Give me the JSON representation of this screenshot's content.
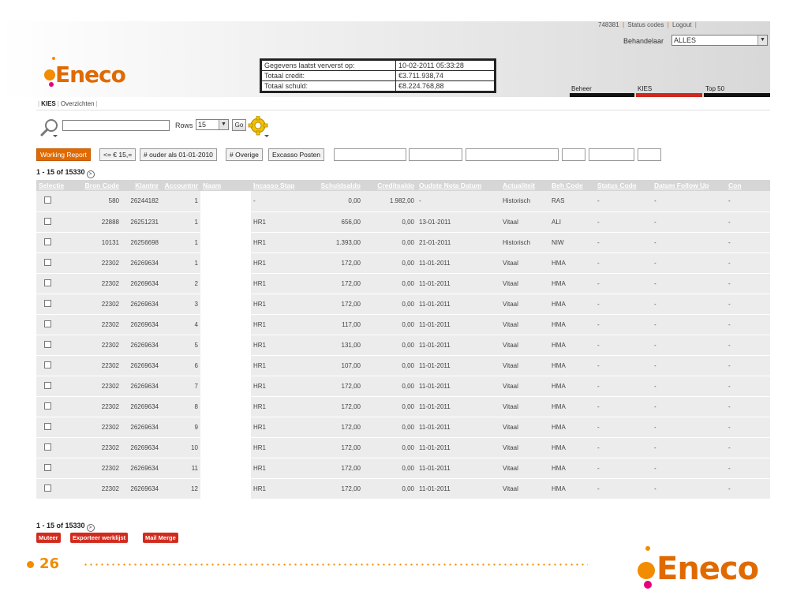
{
  "header": {
    "user_id": "748381",
    "links": [
      "Status codes",
      "Logout"
    ],
    "behandelaar_label": "Behandelaar",
    "behandelaar_value": "ALLES"
  },
  "logo_text": "Eneco",
  "info": [
    {
      "label": "Gegevens laatst ververst op:",
      "value": "10-02-2011 05:33:28"
    },
    {
      "label": "Totaal credit:",
      "value": "€3.711.938,74"
    },
    {
      "label": "Totaal schuld:",
      "value": "€8.224.768,88"
    }
  ],
  "right_tabs": [
    {
      "label": "Beheer",
      "color": "#111111"
    },
    {
      "label": "KIES",
      "color": "#cc2a1e"
    },
    {
      "label": "Top 50",
      "color": "#111111"
    }
  ],
  "breadcrumb": {
    "active": "KIES",
    "item": "Overzichten"
  },
  "search": {
    "rows_label": "Rows",
    "rows_value": "15",
    "go_label": "Go"
  },
  "filters": [
    "Working Report",
    "<= € 15,=",
    "# ouder als 01-01-2010",
    "# Overige",
    "Excasso Posten"
  ],
  "pager_text": "1 - 15 of 15330",
  "columns": [
    "Selectie",
    "Bron Code",
    "Klantnr",
    "Accountnr",
    "Naam",
    "Incasso Stap",
    "Schuldsaldo",
    "Creditsaldo",
    "Oudste Nota Datum",
    "Actualiteit",
    "Beh Code",
    "Status Code",
    "Datum Follow Up",
    "Con"
  ],
  "rows": [
    [
      "580",
      "26244182",
      "1",
      "",
      "-",
      "0,00",
      "1.982,00",
      "-",
      "Historisch",
      "RAS",
      "-",
      "-",
      "-"
    ],
    [
      "22888",
      "26251231",
      "1",
      "",
      "HR1",
      "656,00",
      "0,00",
      "13-01-2011",
      "Vitaal",
      "ALI",
      "-",
      "-",
      "-"
    ],
    [
      "10131",
      "26256698",
      "1",
      "",
      "HR1",
      "1.393,00",
      "0,00",
      "21-01-2011",
      "Historisch",
      "NIW",
      "-",
      "-",
      "-"
    ],
    [
      "22302",
      "26269634",
      "1",
      "",
      "HR1",
      "172,00",
      "0,00",
      "11-01-2011",
      "Vitaal",
      "HMA",
      "-",
      "-",
      "-"
    ],
    [
      "22302",
      "26269634",
      "2",
      "",
      "HR1",
      "172,00",
      "0,00",
      "11-01-2011",
      "Vitaal",
      "HMA",
      "-",
      "-",
      "-"
    ],
    [
      "22302",
      "26269634",
      "3",
      "",
      "HR1",
      "172,00",
      "0,00",
      "11-01-2011",
      "Vitaal",
      "HMA",
      "-",
      "-",
      "-"
    ],
    [
      "22302",
      "26269634",
      "4",
      "",
      "HR1",
      "117,00",
      "0,00",
      "11-01-2011",
      "Vitaal",
      "HMA",
      "-",
      "-",
      "-"
    ],
    [
      "22302",
      "26269634",
      "5",
      "",
      "HR1",
      "131,00",
      "0,00",
      "11-01-2011",
      "Vitaal",
      "HMA",
      "-",
      "-",
      "-"
    ],
    [
      "22302",
      "26269634",
      "6",
      "",
      "HR1",
      "107,00",
      "0,00",
      "11-01-2011",
      "Vitaal",
      "HMA",
      "-",
      "-",
      "-"
    ],
    [
      "22302",
      "26269634",
      "7",
      "",
      "HR1",
      "172,00",
      "0,00",
      "11-01-2011",
      "Vitaal",
      "HMA",
      "-",
      "-",
      "-"
    ],
    [
      "22302",
      "26269634",
      "8",
      "",
      "HR1",
      "172,00",
      "0,00",
      "11-01-2011",
      "Vitaal",
      "HMA",
      "-",
      "-",
      "-"
    ],
    [
      "22302",
      "26269634",
      "9",
      "",
      "HR1",
      "172,00",
      "0,00",
      "11-01-2011",
      "Vitaal",
      "HMA",
      "-",
      "-",
      "-"
    ],
    [
      "22302",
      "26269634",
      "10",
      "",
      "HR1",
      "172,00",
      "0,00",
      "11-01-2011",
      "Vitaal",
      "HMA",
      "-",
      "-",
      "-"
    ],
    [
      "22302",
      "26269634",
      "11",
      "",
      "HR1",
      "172,00",
      "0,00",
      "11-01-2011",
      "Vitaal",
      "HMA",
      "-",
      "-",
      "-"
    ],
    [
      "22302",
      "26269634",
      "12",
      "",
      "HR1",
      "172,00",
      "0,00",
      "11-01-2011",
      "Vitaal",
      "HMA",
      "-",
      "-",
      "-"
    ]
  ],
  "actions": [
    "Muteer",
    "Exporteer werklijst",
    "Mail Merge"
  ],
  "page_number": "26",
  "colors": {
    "accent": "#f28c00",
    "brand_text": "#e06a00",
    "button_red": "#d22b1e",
    "logo_pink": "#e6007e"
  }
}
